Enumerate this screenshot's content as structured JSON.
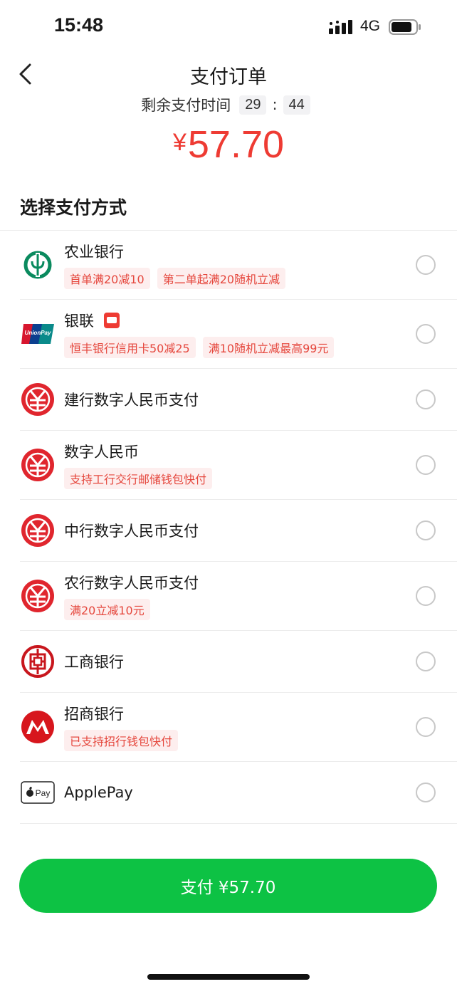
{
  "status_bar": {
    "time": "15:48",
    "network": "4G"
  },
  "header": {
    "title": "支付订单",
    "timer_label": "剩余支付时间",
    "timer_minutes": "29",
    "timer_sep": ":",
    "timer_seconds": "44"
  },
  "amount": {
    "currency": "¥",
    "value": "57.70"
  },
  "section_title": "选择支付方式",
  "methods": [
    {
      "name": "农业银行",
      "icon": "abc-bank-icon",
      "tags": [
        "首单满20减10",
        "第二单起满20随机立减"
      ]
    },
    {
      "name": "银联",
      "icon": "unionpay-icon",
      "tags": [
        "恒丰银行信用卡50减25",
        "满10随机立减最高99元"
      ]
    },
    {
      "name": "建行数字人民币支付",
      "icon": "ecny-icon",
      "tags": []
    },
    {
      "name": "数字人民币",
      "icon": "ecny-icon",
      "tags": [
        "支持工行交行邮储钱包快付"
      ]
    },
    {
      "name": "中行数字人民币支付",
      "icon": "ecny-icon",
      "tags": []
    },
    {
      "name": "农行数字人民币支付",
      "icon": "ecny-icon",
      "tags": [
        "满20立减10元"
      ]
    },
    {
      "name": "工商银行",
      "icon": "icbc-icon",
      "tags": []
    },
    {
      "name": "招商银行",
      "icon": "cmb-icon",
      "tags": [
        "已支持招行钱包快付"
      ]
    },
    {
      "name": "ApplePay",
      "icon": "apple-pay-icon",
      "tags": []
    }
  ],
  "pay_button": "支付 ¥57.70",
  "colors": {
    "accent_red": "#ee3b33",
    "pay_green": "#0dc244",
    "tag_bg": "#fdeeee"
  }
}
